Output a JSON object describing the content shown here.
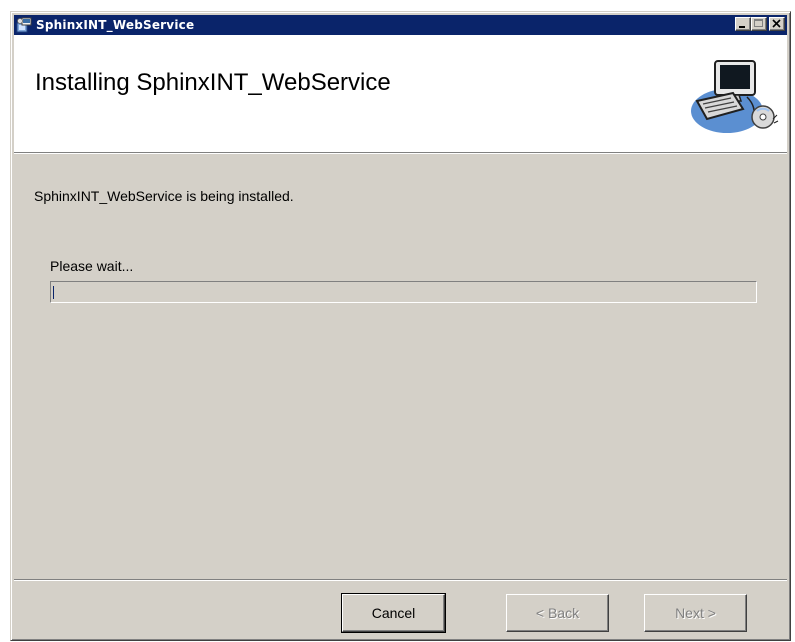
{
  "window": {
    "title": "SphinxINT_WebService"
  },
  "header": {
    "title": "Installing SphinxINT_WebService"
  },
  "body": {
    "status_text": "SphinxINT_WebService is being installed.",
    "wait_text": "Please wait...",
    "progress_percent": 0
  },
  "buttons": {
    "cancel_label": "Cancel",
    "back_label": "< Back",
    "next_label": "Next >"
  },
  "icons": {
    "title_icon": "installer-icon",
    "header_art": "computer-cd-install-icon",
    "minimize": "minimize-icon",
    "maximize": "maximize-icon",
    "close": "close-icon"
  },
  "colors": {
    "title_bar": "#0a246a",
    "dialog_face": "#d4d0c8",
    "header_bg": "#ffffff"
  }
}
